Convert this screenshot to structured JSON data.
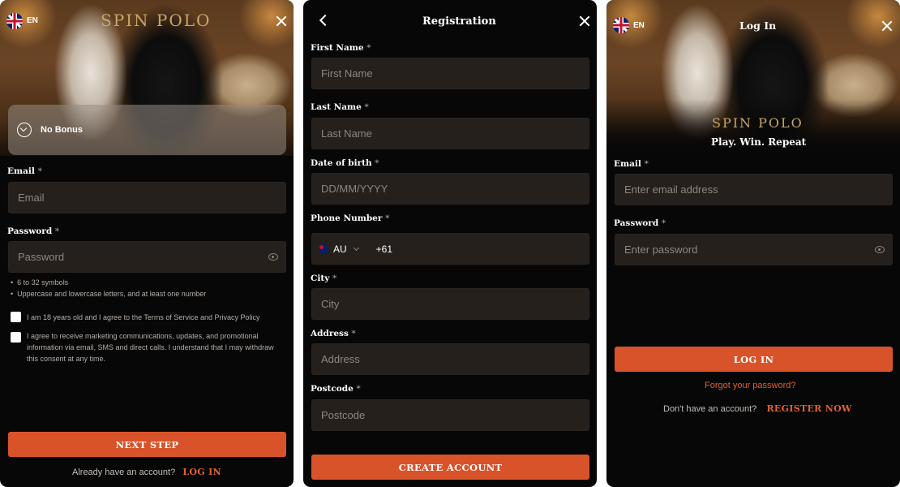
{
  "signup": {
    "lang": "EN",
    "brand": "SPIN POLO",
    "bonus": "No Bonus",
    "email_label": "Email",
    "email_placeholder": "Email",
    "password_label": "Password",
    "password_placeholder": "Password",
    "hints": [
      "6 to 32 symbols",
      "Uppercase and lowercase letters, and at least one number"
    ],
    "check_age": "I am 18 years old and I agree to the Terms of Service and Privacy Policy",
    "check_marketing": "I agree to receive marketing communications, updates, and promotional information via email, SMS and direct calls. I understand that I may withdraw this consent at any time.",
    "next_button": "NEXT STEP",
    "footer_text": "Already have an account?",
    "login_link": "LOG IN"
  },
  "registration": {
    "title": "Registration",
    "first_name_label": "First Name",
    "first_name_placeholder": "First Name",
    "last_name_label": "Last Name",
    "last_name_placeholder": "Last Name",
    "dob_label": "Date of birth",
    "dob_placeholder": "DD/MM/YYYY",
    "phone_label": "Phone Number",
    "country_code": "AU",
    "dial_code": "+61",
    "city_label": "City",
    "city_placeholder": "City",
    "address_label": "Address",
    "address_placeholder": "Address",
    "postcode_label": "Postcode",
    "postcode_placeholder": "Postcode",
    "create_button": "CREATE ACCOUNT"
  },
  "login": {
    "lang": "EN",
    "title": "Log In",
    "brand": "SPIN POLO",
    "tagline": "Play. Win. Repeat",
    "email_label": "Email",
    "email_placeholder": "Enter email address",
    "password_label": "Password",
    "password_placeholder": "Enter password",
    "login_button": "LOG IN",
    "forgot": "Forgot your password?",
    "footer_text": "Don't have an account?",
    "register_link": "REGISTER NOW"
  },
  "required_mark": "*",
  "colors": {
    "accent": "#d9532a",
    "panel_bg": "#070707",
    "input_bg": "#25201c",
    "brand_gold": "#c9a766"
  }
}
